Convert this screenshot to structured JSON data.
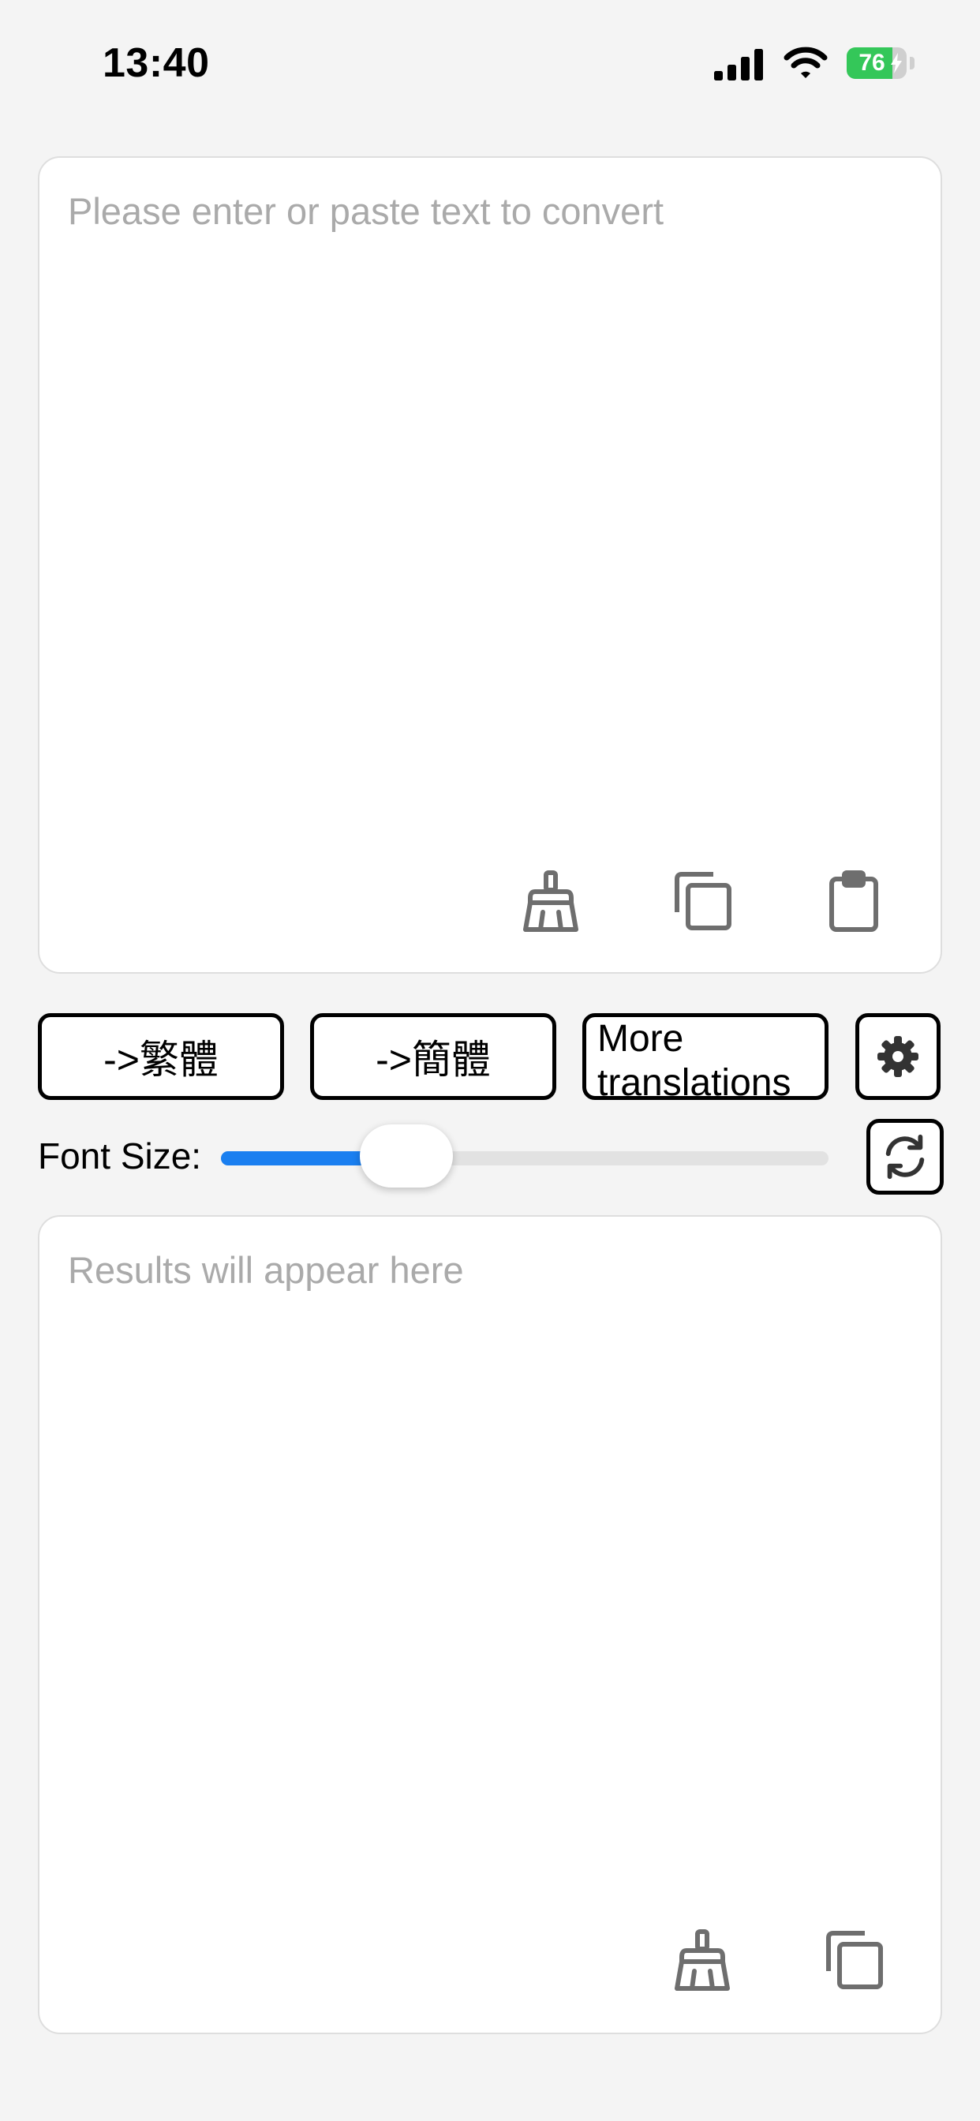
{
  "status_bar": {
    "time": "13:40",
    "battery_level": "76",
    "icons": [
      "signal-icon",
      "wifi-icon",
      "battery-icon"
    ]
  },
  "input_panel": {
    "placeholder": "Please enter or paste text to convert",
    "value": "",
    "actions": [
      "broom-icon",
      "copy-icon",
      "clipboard-icon"
    ]
  },
  "controls": {
    "to_traditional_label": "->繁體",
    "to_simplified_label": "->簡體",
    "more_translations_label": "More translations",
    "settings_icon": "gear-icon",
    "refresh_icon": "refresh-icon"
  },
  "font_size": {
    "label": "Font Size:",
    "value_fraction": 0.27
  },
  "result_panel": {
    "placeholder": "Results will appear here",
    "value": "",
    "actions": [
      "broom-icon",
      "copy-icon"
    ]
  },
  "colors": {
    "background": "#f4f4f4",
    "accent": "#1a7ff0",
    "battery": "#34c759",
    "icon_gray": "#6e6e6e",
    "placeholder": "#aaaaaa"
  }
}
